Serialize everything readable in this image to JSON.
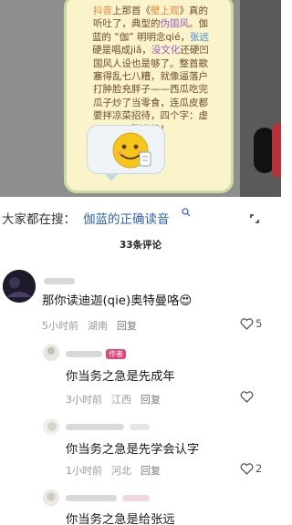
{
  "video_card": {
    "line1_a": "抖音",
    "line1_b": "上那首《",
    "line1_c": "壁上观",
    "line1_d": "》真的",
    "line2": "听吐了，典型的",
    "line2_hl": "伪国风",
    "line2_end": "。伽",
    "line3_a": "蓝的 “伽” 明明念qié，",
    "line3_hl": "张远",
    "line4_a": "硬是唱成jiā，",
    "line4_hl": "没文化",
    "line4_b": "还硬凹",
    "line5": "国风人设也是够了。整首歌",
    "line6": "塞得乱七八糟，就像逼落户",
    "line7": "打肿脸充胖子——西瓜吃完",
    "line8": "瓜子炒了当零食，连瓜皮都",
    "line9": "要拌凉菜招待，四个字：虚",
    "line10": "张声势！"
  },
  "search": {
    "label": "大家都在搜：",
    "link": "伽蓝的正确读音",
    "icon": "search-icon"
  },
  "comments_header": {
    "count": "33条评论"
  },
  "comments": [
    {
      "text": "那你读迪迦(qie)奥特曼咯😍",
      "time": "5小时前",
      "location": "湖南",
      "reply": "回复",
      "likes": "5"
    },
    {
      "badge": "作者",
      "text": "你当务之急是先成年",
      "time": "3小时前",
      "location": "江西",
      "reply": "回复",
      "likes": ""
    },
    {
      "text": "你当务之急是先学会认字",
      "time": "1小时前",
      "location": "河北",
      "reply": "回复",
      "likes": "2"
    },
    {
      "text": "你当务之急是给张远"
    }
  ],
  "colors": {
    "link": "#2f63b8",
    "badge": "#e2457a",
    "card_bg": "#fbf3c9"
  }
}
